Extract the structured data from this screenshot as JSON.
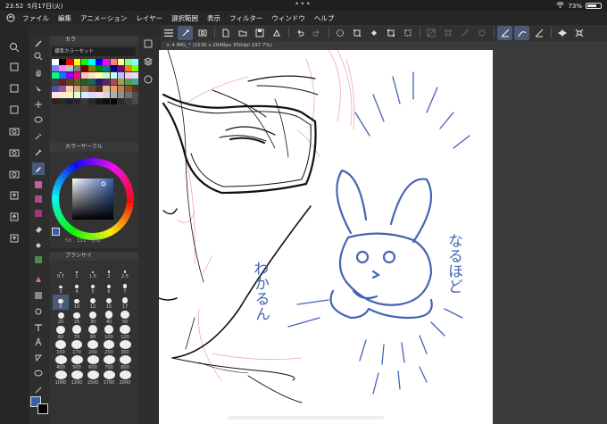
{
  "status": {
    "time": "23:52",
    "date": "5月17日(火)",
    "battery": "73%",
    "battery_level": 0.73
  },
  "menu": {
    "items": [
      "ファイル",
      "編集",
      "アニメーション",
      "レイヤー",
      "選択範囲",
      "表示",
      "フィルター",
      "ウィンドウ",
      "ヘルプ"
    ]
  },
  "color_panel": {
    "tab_label": "カラ",
    "set_name": "標準カラーセット",
    "swatches": [
      "#ffffff",
      "#000000",
      "#ff0000",
      "#ffff00",
      "#00ff00",
      "#00ffff",
      "#0000ff",
      "#ff00ff",
      "#ff8080",
      "#ffff80",
      "#80ff80",
      "#80ffff",
      "#8080ff",
      "#ff80ff",
      "#c0c0c0",
      "#808080",
      "#800000",
      "#808000",
      "#008000",
      "#008080",
      "#000080",
      "#800080",
      "#ff8000",
      "#80ff00",
      "#00ff80",
      "#0080ff",
      "#8000ff",
      "#ff0080",
      "#ffc0c0",
      "#ffe0c0",
      "#ffffc0",
      "#c0ffc0",
      "#c0ffff",
      "#c0c0ff",
      "#ffc0ff",
      "#e0e0e0",
      "#404040",
      "#602020",
      "#604020",
      "#606020",
      "#206020",
      "#206060",
      "#202060",
      "#602060",
      "#a05050",
      "#a0a050",
      "#50a050",
      "#50a0a0",
      "#5050a0",
      "#a050a0",
      "#f0d0b0",
      "#d0a080",
      "#a07050",
      "#705030",
      "#503020",
      "#f0c090",
      "#e0a070",
      "#c08050",
      "#905030",
      "#603010",
      "#ffe0e0",
      "#ffe8d0",
      "#fff0c0",
      "#e0ffd0",
      "#d0f0ff",
      "#e0d8ff",
      "#f8d8f0",
      "#d8d8d8",
      "#b0b0b0",
      "#909090",
      "#707070",
      "#505050",
      "#302020",
      "#203020",
      "#202030",
      "#302030",
      "#383838",
      "#282828",
      "#181818",
      "#101010",
      "#080808",
      "#2a2a2a",
      "#3a3a3a",
      "#4a4a4a"
    ]
  },
  "color_wheel": {
    "tab_label": "カラーサークル",
    "h_value": "58",
    "s_value": "111",
    "v_value": "202",
    "main_color": "#3a5eab"
  },
  "brush_size": {
    "tab_label": "ブラシサイ",
    "sizes": [
      "0.7",
      "1",
      "1.5",
      "2",
      "2.5",
      "3",
      "4",
      "5",
      "6",
      "7",
      "8",
      "10",
      "12",
      "15",
      "17",
      "20",
      "25",
      "30",
      "40",
      "50",
      "60",
      "70",
      "80",
      "100",
      "120",
      "150",
      "170",
      "200",
      "250",
      "300",
      "400",
      "500",
      "600",
      "700",
      "800",
      "1000",
      "1200",
      "1500",
      "1700",
      "2000"
    ],
    "selected_index": 10
  },
  "document": {
    "tab_label": "× 4 IMG_* (1536 x 2048px 350dpi 197.7%)"
  },
  "canvas": {
    "sketch_lines": [
      "わかるん",
      "なるほど"
    ],
    "ink_color": "#4664b4",
    "pencil_color": "#e88aa8"
  }
}
